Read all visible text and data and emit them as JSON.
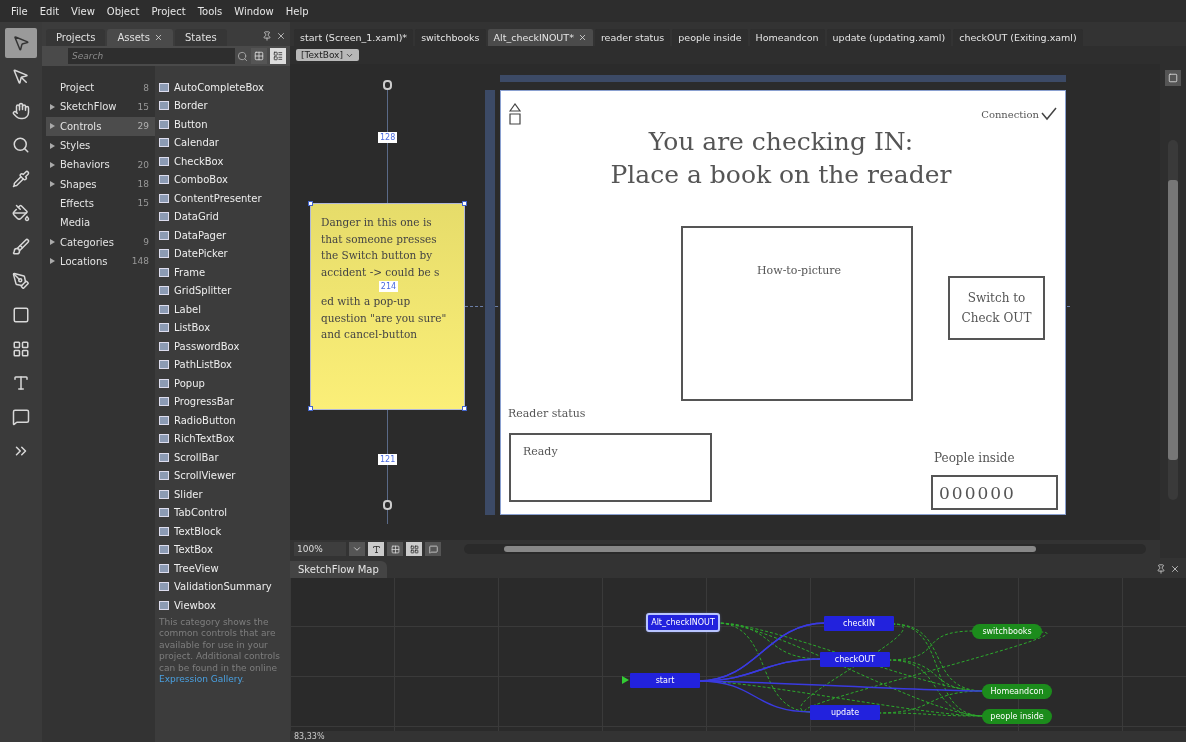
{
  "menu": [
    "File",
    "Edit",
    "View",
    "Object",
    "Project",
    "Tools",
    "Window",
    "Help"
  ],
  "tools": [
    {
      "kind": "select",
      "selected": true
    },
    {
      "kind": "direct",
      "selected": false
    },
    {
      "kind": "pan",
      "selected": false
    },
    {
      "kind": "zoom",
      "selected": false
    },
    {
      "kind": "eyedropper",
      "selected": false
    },
    {
      "kind": "bucket",
      "selected": false
    },
    {
      "kind": "brush",
      "selected": false
    },
    {
      "kind": "pen",
      "selected": false
    },
    {
      "kind": "rectangle",
      "selected": false
    },
    {
      "kind": "grid",
      "selected": false
    },
    {
      "kind": "text",
      "selected": false
    },
    {
      "kind": "callout",
      "selected": false
    },
    {
      "kind": "more",
      "selected": false
    }
  ],
  "panel_tabs": [
    {
      "label": "Projects",
      "selected": false
    },
    {
      "label": "Assets",
      "selected": true
    },
    {
      "label": "States",
      "selected": false
    }
  ],
  "search": {
    "placeholder": "Search"
  },
  "categories": [
    {
      "label": "Project",
      "count": "8",
      "expandable": false,
      "selected": false
    },
    {
      "label": "SketchFlow",
      "count": "15",
      "expandable": true,
      "selected": false
    },
    {
      "label": "Controls",
      "count": "29",
      "expandable": true,
      "selected": true
    },
    {
      "label": "Styles",
      "expandable": true,
      "selected": false
    },
    {
      "label": "Behaviors",
      "count": "20",
      "expandable": true,
      "selected": false
    },
    {
      "label": "Shapes",
      "count": "18",
      "expandable": true,
      "selected": false
    },
    {
      "label": "Effects",
      "count": "15",
      "expandable": false,
      "selected": false
    },
    {
      "label": "Media",
      "expandable": false,
      "selected": false
    },
    {
      "label": "Categories",
      "count": "9",
      "expandable": true,
      "selected": false
    },
    {
      "label": "Locations",
      "count": "148",
      "expandable": true,
      "selected": false
    }
  ],
  "controls": [
    "AutoCompleteBox",
    "Border",
    "Button",
    "Calendar",
    "CheckBox",
    "ComboBox",
    "ContentPresenter",
    "DataGrid",
    "DataPager",
    "DatePicker",
    "Frame",
    "GridSplitter",
    "Label",
    "ListBox",
    "PasswordBox",
    "PathListBox",
    "Popup",
    "ProgressBar",
    "RadioButton",
    "RichTextBox",
    "ScrollBar",
    "ScrollViewer",
    "Slider",
    "TabControl",
    "TextBlock",
    "TextBox",
    "TreeView",
    "ValidationSummary",
    "Viewbox"
  ],
  "description": {
    "text": "This category shows the common controls that are available for use in your project. Additional controls can be found in the online ",
    "link": "Expression Gallery",
    "end": "."
  },
  "document_tabs": [
    {
      "label": "start (Screen_1.xaml)*",
      "selected": false
    },
    {
      "label": "switchbooks",
      "selected": false
    },
    {
      "label": "Alt_checkINOUT*",
      "selected": true
    },
    {
      "label": "reader status",
      "selected": false
    },
    {
      "label": "people inside",
      "selected": false
    },
    {
      "label": "Homeandcon",
      "selected": false
    },
    {
      "label": "update (updating.xaml)",
      "selected": false
    },
    {
      "label": "checkOUT (Exiting.xaml)",
      "selected": false
    }
  ],
  "breadcrumb": "[TextBox]",
  "note": {
    "text_before": "Danger in this one is that someone presses the Switch button by accident -> could be s",
    "measure": "214",
    "text_after": "ed with a pop-up question \"are you sure\" and cancel-button"
  },
  "rulers": [
    "128",
    "121"
  ],
  "screen": {
    "title_lines": [
      "You are checking IN:",
      "Place a book on the reader"
    ],
    "connection": "Connection",
    "picture_label": "How-to-picture",
    "switch_button": "Switch to Check OUT",
    "reader_status_label": "Reader status",
    "reader_status": "Ready",
    "people_label": "People inside",
    "people_count": "000000"
  },
  "zoom": "100%",
  "map": {
    "title": "SketchFlow Map",
    "zoom": "83,33%",
    "nodes": [
      {
        "label": "Alt_checkINOUT",
        "kind": "screen",
        "selected": true
      },
      {
        "label": "checkIN",
        "kind": "screen",
        "selected": false
      },
      {
        "label": "switchbooks",
        "kind": "component",
        "selected": false
      },
      {
        "label": "checkOUT",
        "kind": "screen",
        "selected": false
      },
      {
        "label": "start",
        "kind": "screen",
        "selected": false
      },
      {
        "label": "Homeandcon",
        "kind": "component",
        "selected": false
      },
      {
        "label": "update",
        "kind": "screen",
        "selected": false
      },
      {
        "label": "people inside",
        "kind": "component",
        "selected": false
      }
    ]
  }
}
